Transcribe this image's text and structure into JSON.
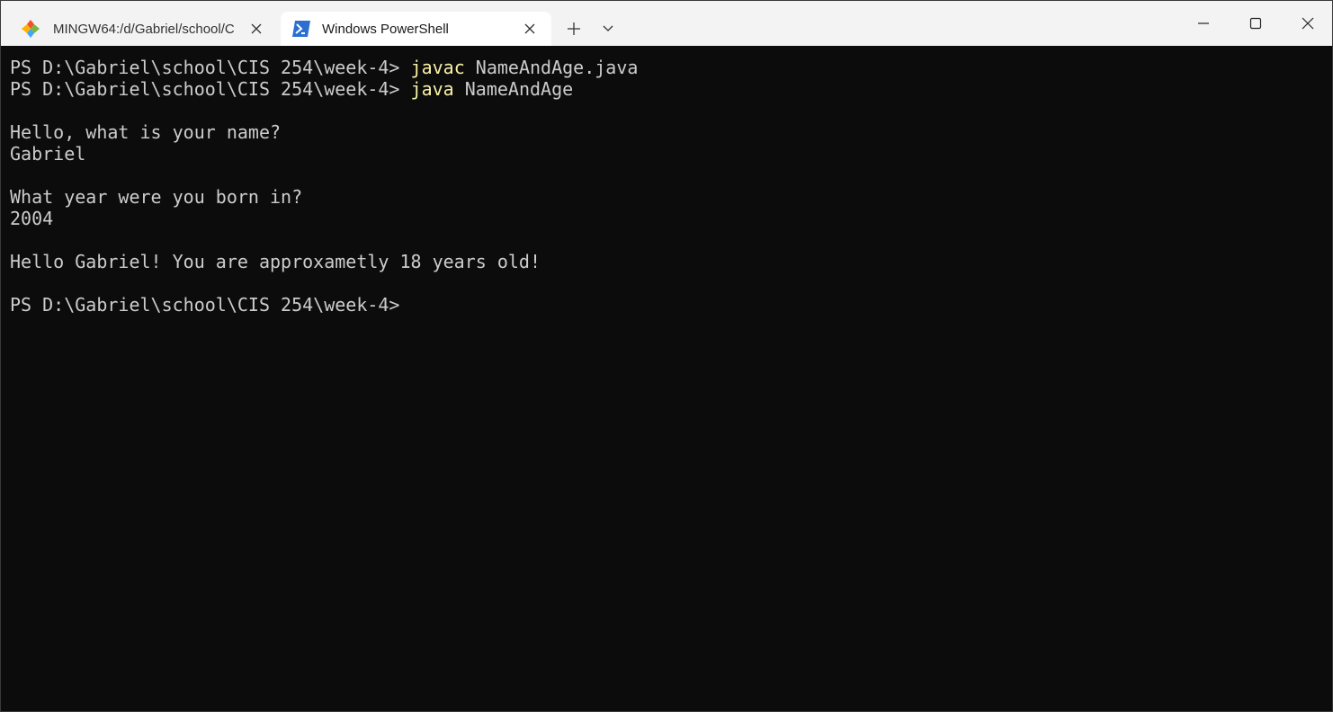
{
  "tabs": [
    {
      "title": "MINGW64:/d/Gabriel/school/C",
      "icon": "git-bash-icon",
      "active": false
    },
    {
      "title": "Windows PowerShell",
      "icon": "powershell-icon",
      "active": true
    }
  ],
  "colors": {
    "background": "#0c0c0c",
    "text": "#cccccc",
    "command": "#f9f1a5",
    "titlebar": "#f3f3f3",
    "active_tab": "#ffffff"
  },
  "terminal": {
    "prompt": "PS D:\\Gabriel\\school\\CIS 254\\week-4> ",
    "lines": [
      {
        "type": "command",
        "prompt": "PS D:\\Gabriel\\school\\CIS 254\\week-4> ",
        "cmd": "javac",
        "args": " NameAndAge.java"
      },
      {
        "type": "command",
        "prompt": "PS D:\\Gabriel\\school\\CIS 254\\week-4> ",
        "cmd": "java",
        "args": " NameAndAge"
      },
      {
        "type": "text",
        "text": ""
      },
      {
        "type": "text",
        "text": "Hello, what is your name?"
      },
      {
        "type": "text",
        "text": "Gabriel"
      },
      {
        "type": "text",
        "text": ""
      },
      {
        "type": "text",
        "text": "What year were you born in?"
      },
      {
        "type": "text",
        "text": "2004"
      },
      {
        "type": "text",
        "text": ""
      },
      {
        "type": "text",
        "text": "Hello Gabriel! You are approxametly 18 years old!"
      },
      {
        "type": "text",
        "text": ""
      },
      {
        "type": "prompt",
        "prompt": "PS D:\\Gabriel\\school\\CIS 254\\week-4>"
      }
    ]
  }
}
